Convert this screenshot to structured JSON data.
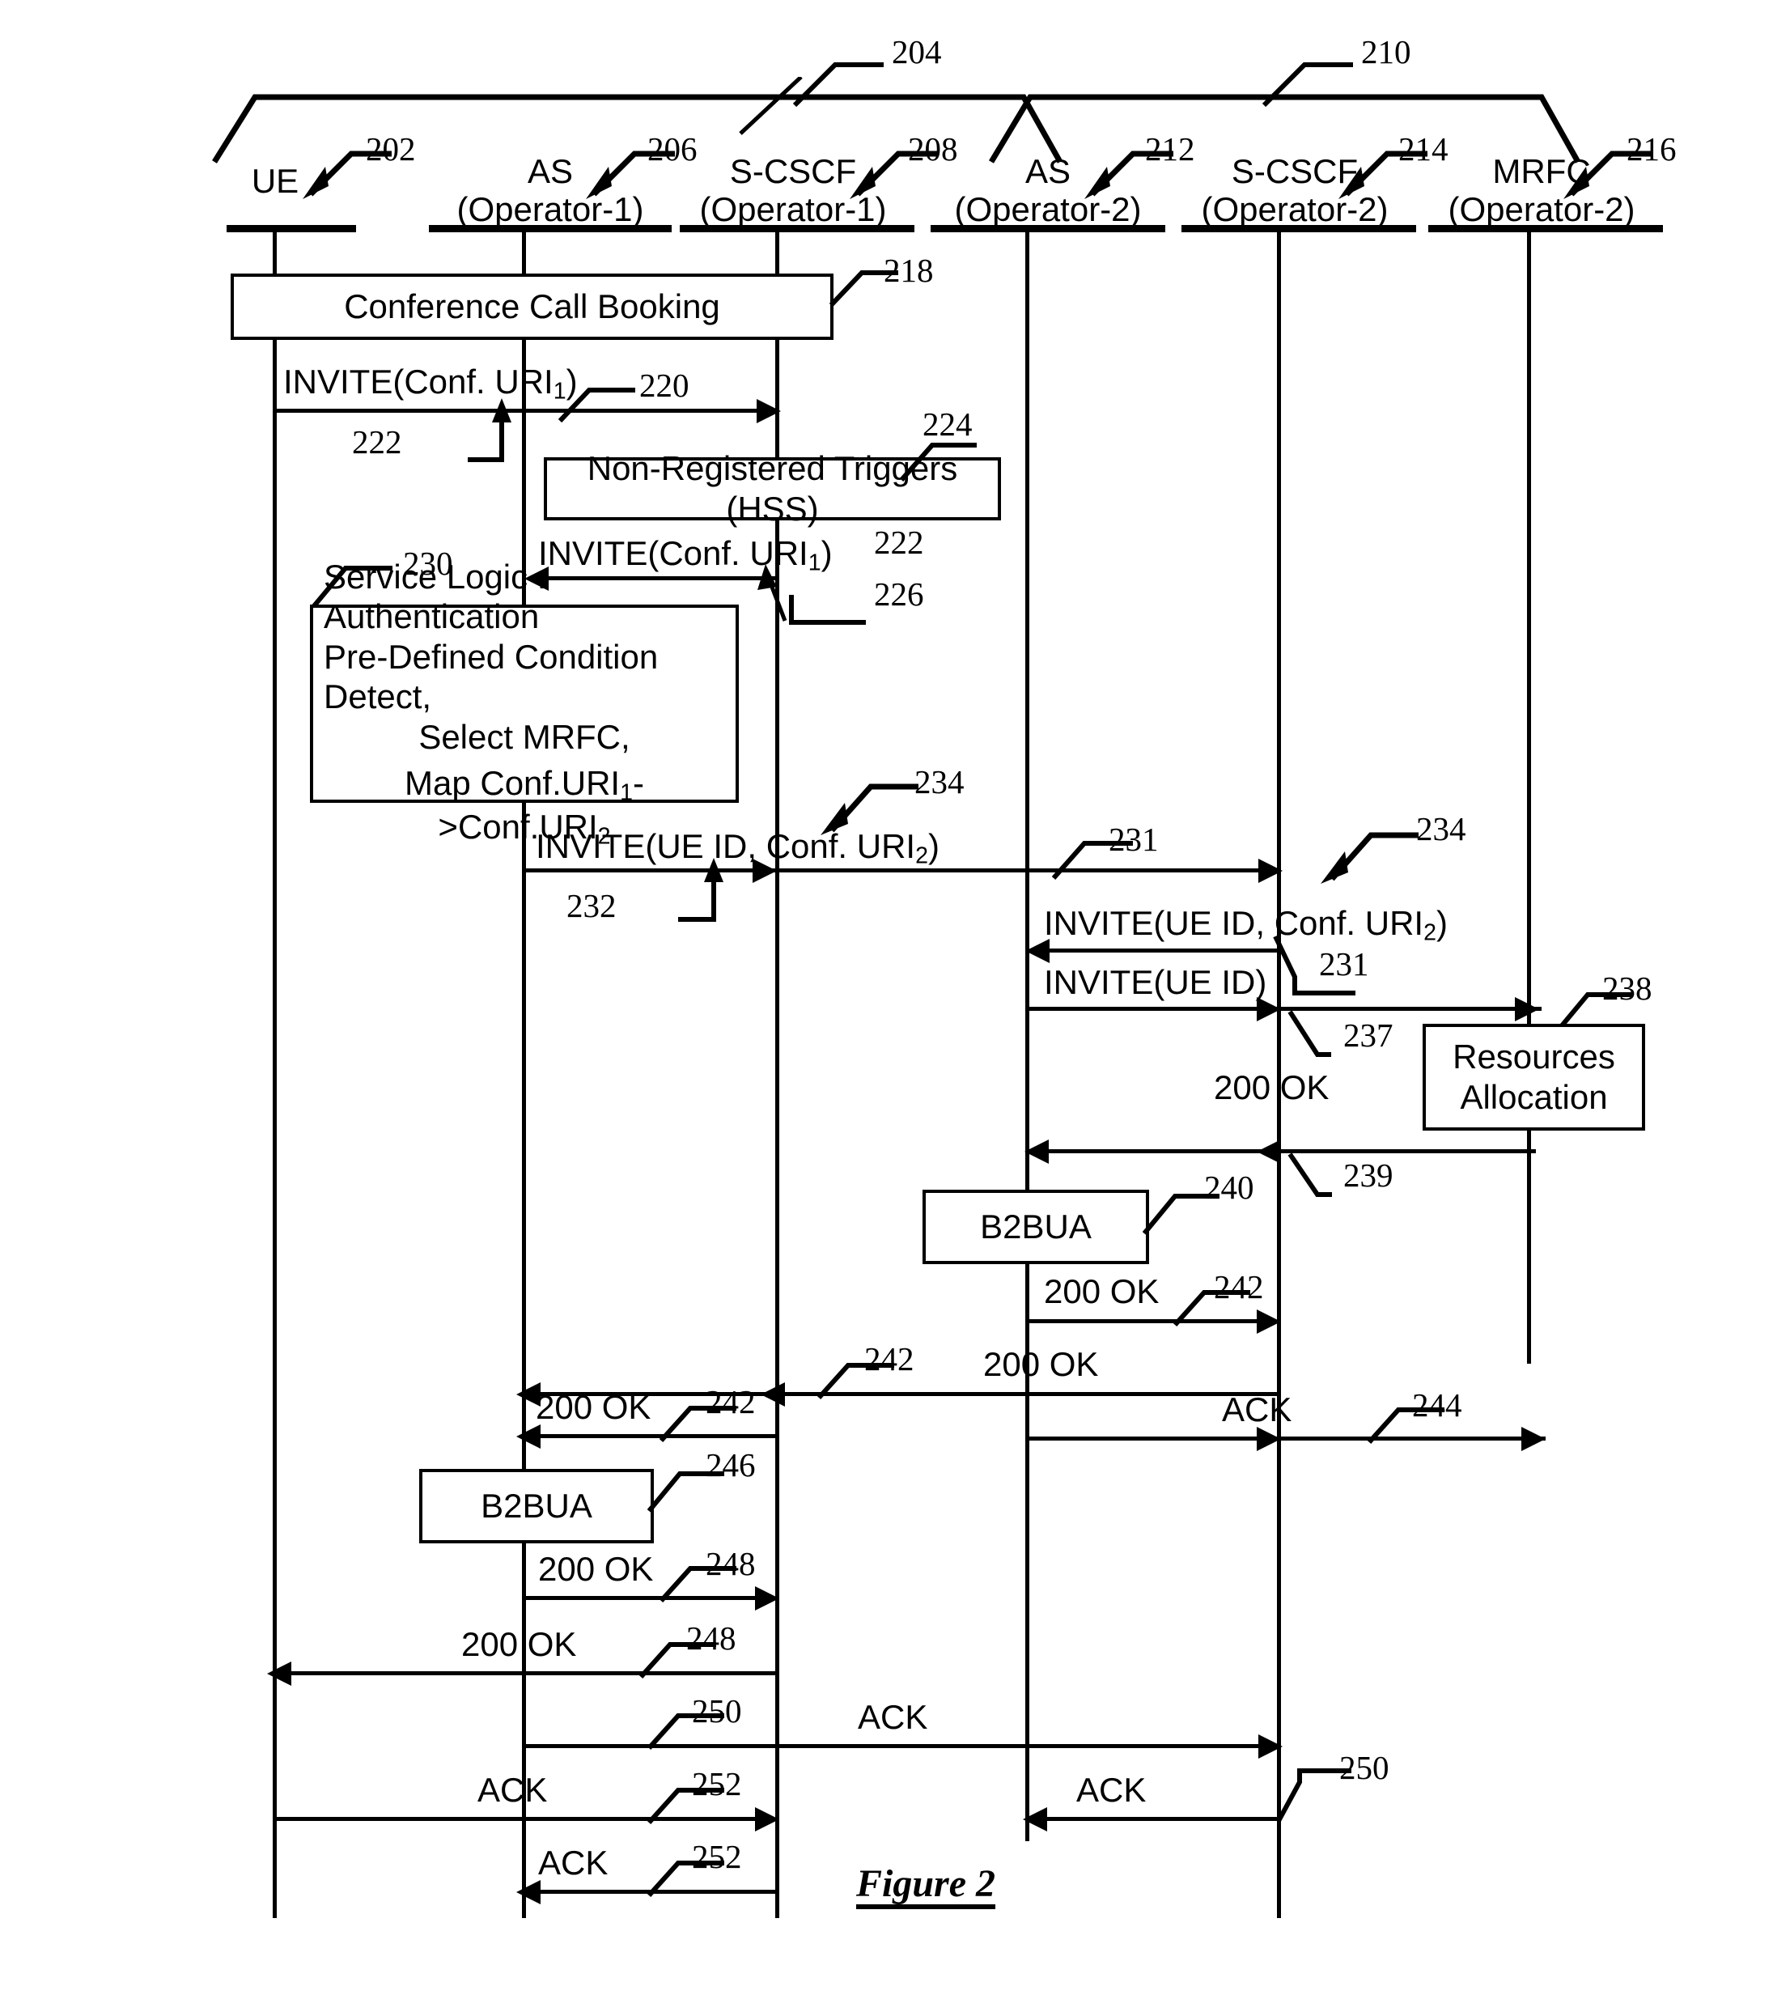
{
  "figure": {
    "caption": "Figure  2",
    "type": "sip-sequence-diagram"
  },
  "groups": [
    {
      "ref": "204",
      "label": "Operator-1 domain bracket",
      "spans": [
        "UE",
        "AS (Operator-1)",
        "S-CSCF (Operator-1)"
      ]
    },
    {
      "ref": "210",
      "label": "Operator-2 domain bracket",
      "spans": [
        "AS (Operator-2)",
        "S-CSCF (Operator-2)",
        "MRFC (Operator-2)"
      ]
    }
  ],
  "lifelines": [
    {
      "id": "ue",
      "ref": "202",
      "name": "UE",
      "sub": ""
    },
    {
      "id": "as1",
      "ref": "206",
      "name": "AS",
      "sub": "(Operator-1)"
    },
    {
      "id": "scscf1",
      "ref": "208",
      "name": "S-CSCF",
      "sub": "(Operator-1)"
    },
    {
      "id": "as2",
      "ref": "212",
      "name": "AS",
      "sub": "(Operator-2)"
    },
    {
      "id": "scscf2",
      "ref": "214",
      "name": "S-CSCF",
      "sub": "(Operator-2)"
    },
    {
      "id": "mrfc",
      "ref": "216",
      "name": "MRFC",
      "sub": "(Operator-2)"
    }
  ],
  "boxes": [
    {
      "id": "booking",
      "ref": "218",
      "lines": [
        "Conference Call Booking"
      ]
    },
    {
      "id": "triggers",
      "ref": "224",
      "lines": [
        "Non-Registered Triggers (HSS)"
      ]
    },
    {
      "id": "servicelogic",
      "ref": "230",
      "lines": [
        "Service Logic : Authentication",
        "Pre-Defined Condition Detect,",
        "Select MRFC,",
        "Map Conf.URI₁->Conf.URI₂"
      ]
    },
    {
      "id": "resources",
      "ref": "238",
      "lines": [
        "Resources",
        "Allocation"
      ]
    },
    {
      "id": "b2bua2",
      "ref": "240",
      "lines": [
        "B2BUA"
      ]
    },
    {
      "id": "b2bua1",
      "ref": "246",
      "lines": [
        "B2BUA"
      ]
    }
  ],
  "messages": [
    {
      "id": "m220",
      "ref": "220",
      "extra_ref": "222",
      "text": "INVITE(Conf. URI₁)",
      "from": "ue",
      "to": "scscf1",
      "dir": "right"
    },
    {
      "id": "m226",
      "ref": "226",
      "extra_ref": "222",
      "text": "INVITE(Conf. URI₁)",
      "from": "scscf1",
      "to": "as1",
      "dir": "left"
    },
    {
      "id": "m232",
      "ref": "234",
      "extra_ref": "232",
      "text": "INVITE(UE ID, Conf. URI₂)",
      "from": "as1",
      "to": "scscf2",
      "dir": "right"
    },
    {
      "id": "m231a",
      "ref": "231",
      "extra_ref": "",
      "text": "",
      "from": "scscf1",
      "to": "scscf2",
      "dir": "right"
    },
    {
      "id": "m234b",
      "ref": "234",
      "extra_ref": "231",
      "text": "INVITE(UE ID, Conf. URI₂)",
      "from": "scscf2",
      "to": "as2",
      "dir": "left"
    },
    {
      "id": "m237",
      "ref": "237",
      "extra_ref": "",
      "text": "INVITE(UE ID)",
      "from": "as2",
      "to": "mrfc",
      "dir": "right"
    },
    {
      "id": "m239",
      "ref": "239",
      "extra_ref": "",
      "text": "200 OK",
      "from": "mrfc",
      "to": "as2",
      "dir": "left"
    },
    {
      "id": "m242a",
      "ref": "242",
      "extra_ref": "",
      "text": "200 OK",
      "from": "as2",
      "to": "scscf2",
      "dir": "right"
    },
    {
      "id": "m242b",
      "ref": "242",
      "extra_ref": "",
      "text": "200 OK",
      "from": "scscf2",
      "to": "as1",
      "dir": "left"
    },
    {
      "id": "m244",
      "ref": "244",
      "extra_ref": "",
      "text": "ACK",
      "from": "as2",
      "to": "mrfc",
      "dir": "right"
    },
    {
      "id": "m242c",
      "ref": "242",
      "extra_ref": "",
      "text": "200 OK",
      "from": "scscf1",
      "to": "as1",
      "dir": "left"
    },
    {
      "id": "m248a",
      "ref": "248",
      "extra_ref": "",
      "text": "200 OK",
      "from": "as1",
      "to": "scscf1",
      "dir": "right"
    },
    {
      "id": "m248b",
      "ref": "248",
      "extra_ref": "",
      "text": "200 OK",
      "from": "scscf1",
      "to": "ue",
      "dir": "left"
    },
    {
      "id": "m250a",
      "ref": "250",
      "extra_ref": "",
      "text": "ACK",
      "from": "as1",
      "to": "scscf2",
      "dir": "right"
    },
    {
      "id": "m250b",
      "ref": "250",
      "extra_ref": "",
      "text": "ACK",
      "from": "scscf2",
      "to": "as2",
      "dir": "left"
    },
    {
      "id": "m252a",
      "ref": "252",
      "extra_ref": "",
      "text": "ACK",
      "from": "ue",
      "to": "scscf1",
      "dir": "right"
    },
    {
      "id": "m252b",
      "ref": "252",
      "extra_ref": "",
      "text": "ACK",
      "from": "scscf1",
      "to": "as1",
      "dir": "left"
    }
  ],
  "labels": {
    "ref_202": "202",
    "ref_204": "204",
    "ref_206": "206",
    "ref_208": "208",
    "ref_210": "210",
    "ref_212": "212",
    "ref_214": "214",
    "ref_216": "216",
    "ref_218": "218",
    "ref_220": "220",
    "ref_222a": "222",
    "ref_222b": "222",
    "ref_224": "224",
    "ref_226": "226",
    "ref_230": "230",
    "ref_231a": "231",
    "ref_231b": "231",
    "ref_232": "232",
    "ref_234a": "234",
    "ref_234b": "234",
    "ref_237": "237",
    "ref_238": "238",
    "ref_239": "239",
    "ref_240": "240",
    "ref_242a": "242",
    "ref_242b": "242",
    "ref_242c": "242",
    "ref_244": "244",
    "ref_246": "246",
    "ref_248a": "248",
    "ref_248b": "248",
    "ref_250a": "250",
    "ref_250b": "250",
    "ref_252a": "252",
    "ref_252b": "252",
    "ue": "UE",
    "as": "AS",
    "scscf": "S-CSCF",
    "mrfc": "MRFC",
    "operator1": "(Operator-1)",
    "operator2": "(Operator-2)",
    "booking": "Conference Call Booking",
    "triggers": "Non-Registered Triggers (HSS)",
    "sl_line1": "Service Logic : Authentication",
    "sl_line2": "Pre-Defined Condition Detect,",
    "sl_line3": "Select MRFC,",
    "sl_line4a": "Map Conf.URI",
    "sl_line4b": "->Conf.URI",
    "res_line1": "Resources",
    "res_line2": "Allocation",
    "b2bua": "B2BUA",
    "invite_conf_uri1_a": "INVITE(Conf. URI",
    "invite_conf_uri1_b": ")",
    "invite_ueid_conf_uri2_a": "INVITE(UE ID, Conf. URI",
    "invite_ueid_conf_uri2_b": ")",
    "invite_ueid": "INVITE(UE ID)",
    "ok200": "200 OK",
    "ack": "ACK",
    "sub1": "1",
    "sub2": "2",
    "figure_caption": "Figure  2"
  }
}
